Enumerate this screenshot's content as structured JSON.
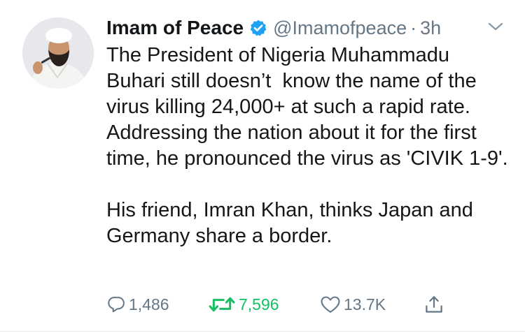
{
  "tweet": {
    "author": {
      "display_name": "Imam of Peace",
      "handle": "@Imamofpeace",
      "separator": "·",
      "timestamp": "3h",
      "verified": true
    },
    "text": {
      "paragraph_1": "The President of Nigeria Muhammadu Buhari still doesn’t  know the name of the virus killing 24,000+ at such a rapid rate. Addressing the nation about it for the first time, he pronounced the virus as 'CIVIK 1-9'.",
      "paragraph_2": "His friend, Imran Khan, thinks Japan and Germany share a border."
    },
    "actions": {
      "replies": "1,486",
      "retweets": "7,596",
      "likes": "13.7K"
    }
  },
  "icons": {
    "verified": "verified-badge-icon",
    "caret": "chevron-down-icon",
    "reply": "reply-icon",
    "retweet": "retweet-icon",
    "like": "heart-icon",
    "share": "share-icon"
  },
  "colors": {
    "text": "#14171a",
    "secondary": "#657786",
    "verified_blue": "#1da1f2",
    "retweet_green": "#17bf63",
    "divider": "#e6ecf0"
  }
}
